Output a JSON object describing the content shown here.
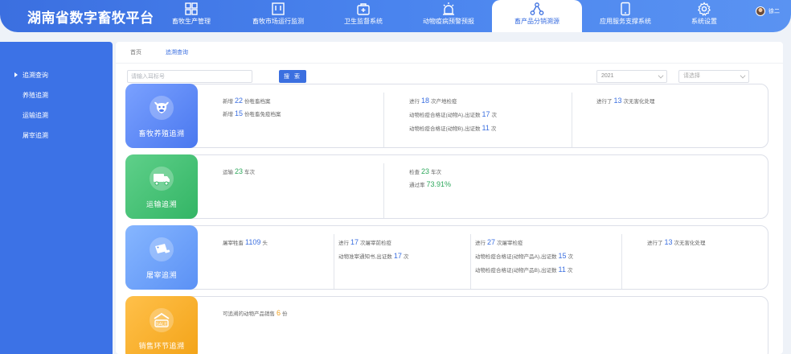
{
  "header": {
    "title": "湖南省数字畜牧平台",
    "nav": [
      {
        "label": "畜牧生产管理",
        "icon": "grid-icon"
      },
      {
        "label": "畜牧市场运行监测",
        "icon": "monitor-frame-icon"
      },
      {
        "label": "卫生监督系统",
        "icon": "medical-kit-icon"
      },
      {
        "label": "动物疫病预警预报",
        "icon": "alarm-light-icon"
      },
      {
        "label": "畜产品分销溯源",
        "icon": "network-nodes-icon"
      },
      {
        "label": "应用服务支撑系统",
        "icon": "tablet-icon"
      },
      {
        "label": "系统设置",
        "icon": "gear-icon"
      }
    ],
    "active_nav": "畜产品分销溯源",
    "user": {
      "name": "徐二"
    }
  },
  "sidebar": {
    "items": [
      {
        "label": "追溯查询"
      },
      {
        "label": "养殖追溯"
      },
      {
        "label": "运输追溯"
      },
      {
        "label": "屠宰追溯"
      }
    ],
    "active": "追溯查询"
  },
  "breadcrumb": {
    "home": "首页",
    "current": "追溯查询"
  },
  "search": {
    "placeholder": "请输入耳标号",
    "button": "搜 索"
  },
  "filters": {
    "year": "2021",
    "type_placeholder": "请选择"
  },
  "cards": {
    "breeding": {
      "title": "畜牧养殖追溯",
      "col1_line1": {
        "pre": "新增",
        "num": "22",
        "post": "份牲畜档案"
      },
      "col1_line2": {
        "pre": "新增",
        "num": "15",
        "post": "份牲畜免疫档案"
      },
      "col2_line1": {
        "pre": "进行",
        "num": "18",
        "post": "次产地检疫"
      },
      "col2_line2": {
        "pre": "动物检疫合格证(动物A),出证数",
        "num": "17",
        "post": "次"
      },
      "col2_line3": {
        "pre": "动物检疫合格证(动物B),出证数",
        "num": "11",
        "post": "次"
      },
      "col3_line1": {
        "pre": "进行了",
        "num": "13",
        "post": "次无害化处理"
      }
    },
    "transport": {
      "title": "运输追溯",
      "col1_line1": {
        "pre": "运输",
        "num": "23",
        "post": "车次"
      },
      "col2_line1": {
        "pre": "检查",
        "num": "23",
        "post": "车次"
      },
      "col2_line2": {
        "pre": "通过率",
        "num": "73.91%",
        "post": ""
      }
    },
    "slaughter": {
      "title": "屠宰追溯",
      "col1_line1": {
        "pre": "屠宰牲畜",
        "num": "1109",
        "post": "头"
      },
      "col2_line1": {
        "pre": "进行",
        "num": "17",
        "post": "次屠宰前检疫"
      },
      "col2_line2": {
        "pre": "动物准宰通知书,出证数",
        "num": "17",
        "post": "次"
      },
      "col3_line1": {
        "pre": "进行",
        "num": "27",
        "post": "次屠宰检疫"
      },
      "col3_line2": {
        "pre": "动物检疫合格证(动物产品A),出证数",
        "num": "15",
        "post": "次"
      },
      "col3_line3": {
        "pre": "动物检疫合格证(动物产品B),出证数",
        "num": "11",
        "post": "次"
      },
      "col4_line1": {
        "pre": "进行了",
        "num": "13",
        "post": "次无害化处理"
      }
    },
    "sales": {
      "title": "销售环节追溯",
      "badge": "SALE",
      "col1_line1": {
        "pre": "可追溯的动物产品销售",
        "num": "6",
        "post": "份"
      }
    }
  },
  "colors": {
    "primary": "#3b6fe0",
    "green": "#2ea85c",
    "orange": "#f0a020"
  }
}
